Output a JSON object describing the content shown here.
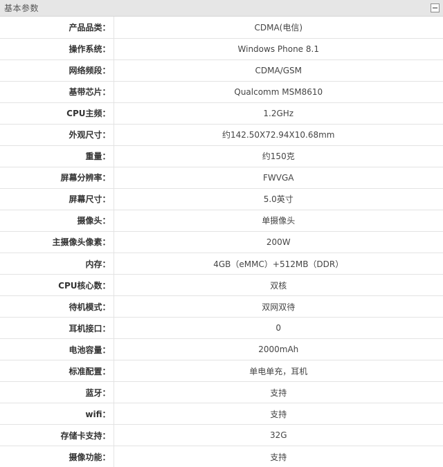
{
  "panel": {
    "title": "基本参数",
    "collapse_icon": "minus-square-icon"
  },
  "colors": {
    "header_bg": "#e6e6e6",
    "border": "#e3e3e3",
    "label_text": "#333333",
    "value_text": "#444444"
  },
  "params": [
    {
      "label": "产品品类：",
      "value": "CDMA(电信)"
    },
    {
      "label": "操作系统：",
      "value": "Windows Phone 8.1"
    },
    {
      "label": "网络频段：",
      "value": "CDMA/GSM"
    },
    {
      "label": "基带芯片：",
      "value": "Qualcomm MSM8610"
    },
    {
      "label": "CPU主频：",
      "value": "1.2GHz"
    },
    {
      "label": "外观尺寸：",
      "value": "约142.50X72.94X10.68mm"
    },
    {
      "label": "重量：",
      "value": "约150克"
    },
    {
      "label": "屏幕分辨率：",
      "value": "FWVGA"
    },
    {
      "label": "屏幕尺寸：",
      "value": "5.0英寸"
    },
    {
      "label": "摄像头：",
      "value": "单摄像头"
    },
    {
      "label": "主摄像头像素：",
      "value": "200W"
    },
    {
      "label": "内存：",
      "value": "4GB（eMMC）+512MB（DDR）"
    },
    {
      "label": "CPU核心数：",
      "value": "双核"
    },
    {
      "label": "待机模式：",
      "value": "双网双待"
    },
    {
      "label": "耳机接口：",
      "value": "0"
    },
    {
      "label": "电池容量：",
      "value": "2000mAh"
    },
    {
      "label": "标准配置：",
      "value": "单电单充，耳机"
    },
    {
      "label": "蓝牙：",
      "value": "支持"
    },
    {
      "label": "wifi：",
      "value": "支持"
    },
    {
      "label": "存储卡支持：",
      "value": "32G"
    },
    {
      "label": "摄像功能：",
      "value": "支持"
    }
  ]
}
